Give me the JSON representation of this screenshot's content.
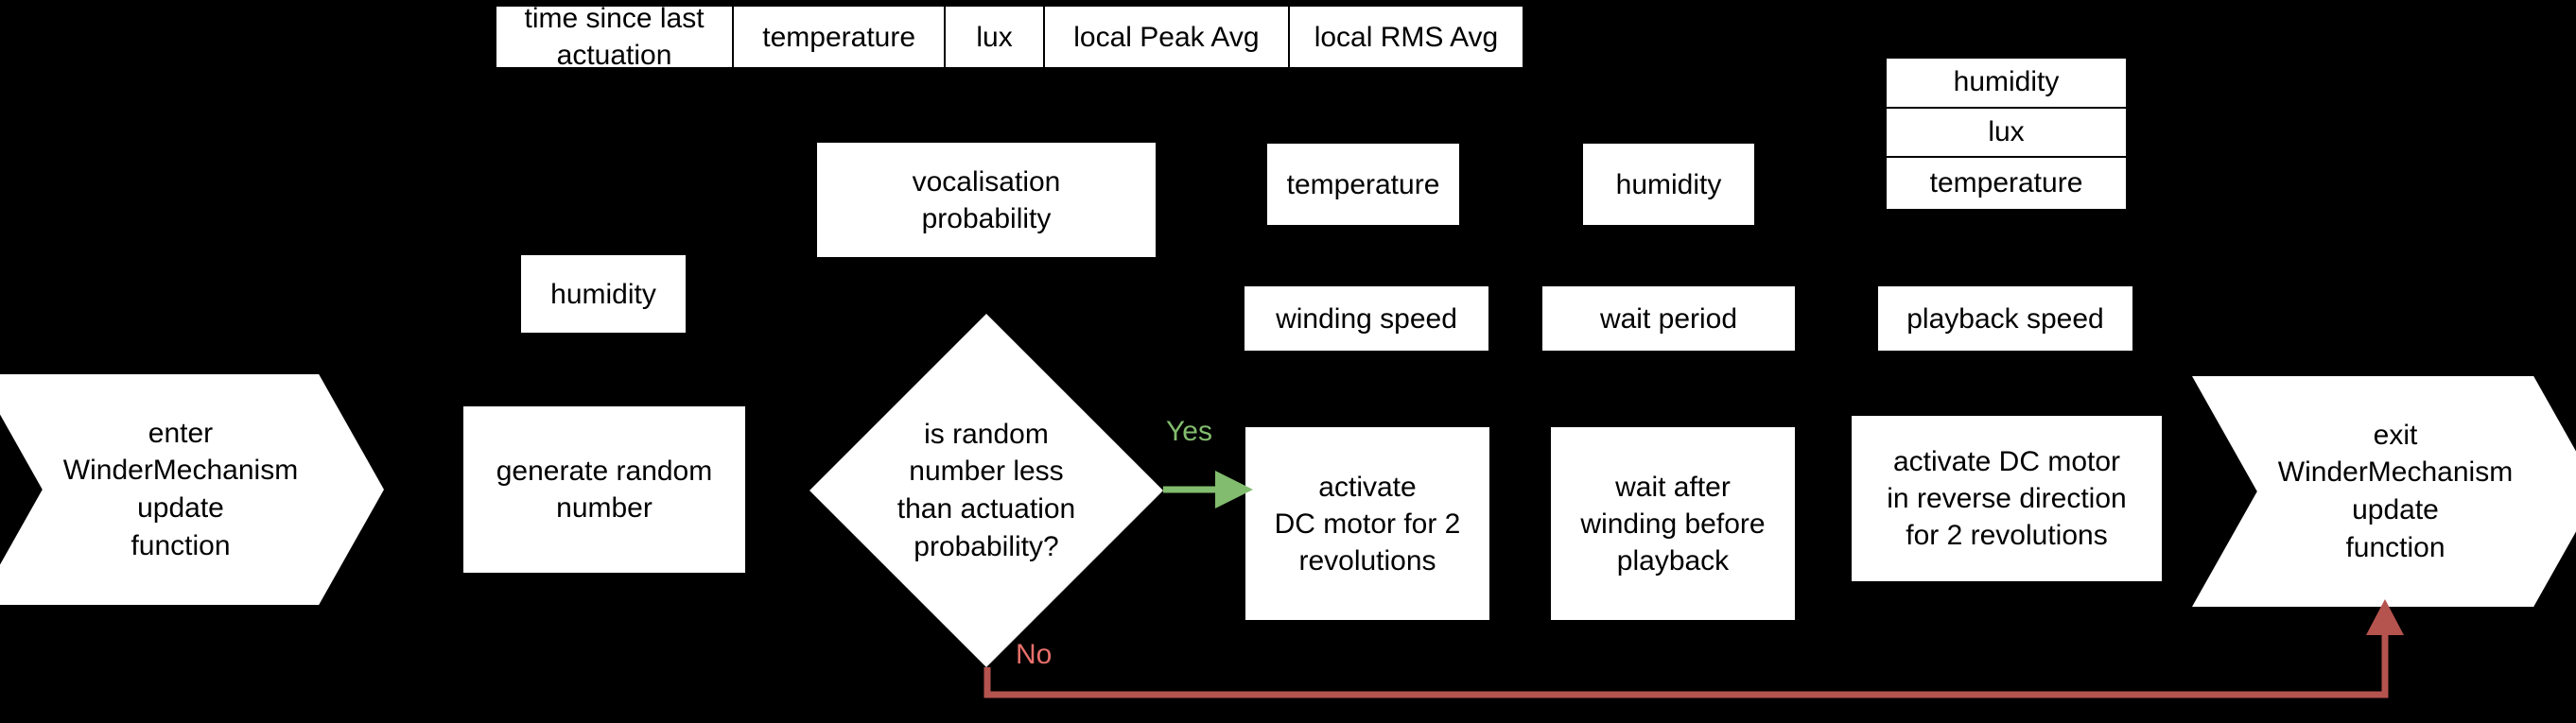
{
  "diagram": {
    "title": "WinderMechanism update function flowchart",
    "background": "#000000",
    "node_fill": "#ffffff",
    "node_stroke": "#000000",
    "yes_color": "#82bc6e",
    "no_label_color": "#e8706b",
    "no_line_color": "#b5534e"
  },
  "header_row": {
    "cells": [
      {
        "label": "time since last\nactuation"
      },
      {
        "label": "temperature"
      },
      {
        "label": "lux"
      },
      {
        "label": "local Peak Avg"
      },
      {
        "label": "local RMS Avg"
      }
    ]
  },
  "nodes": {
    "enter": {
      "label": "enter\nWinderMechanism\nupdate\nfunction"
    },
    "exit": {
      "label": "exit\nWinderMechanism\nupdate\nfunction"
    },
    "humidity_left": {
      "label": "humidity"
    },
    "generate_random_number": {
      "label": "generate random\nnumber"
    },
    "vocalisation_probability": {
      "label": "vocalisation\nprobability"
    },
    "decision": {
      "label": "is random\nnumber less\nthan actuation\nprobability?"
    },
    "temperature_mid": {
      "label": "temperature"
    },
    "winding_speed": {
      "label": "winding speed"
    },
    "activate_dc_motor": {
      "label": "activate\nDC motor for 2\nrevolutions"
    },
    "humidity_mid": {
      "label": "humidity"
    },
    "wait_period": {
      "label": "wait period"
    },
    "wait_after_winding": {
      "label": "wait after\nwinding before\nplayback"
    },
    "playback_speed": {
      "label": "playback speed"
    },
    "activate_dc_motor_reverse": {
      "label": "activate DC motor\nin reverse direction\nfor 2 revolutions"
    }
  },
  "right_stack": {
    "cells": [
      {
        "label": "humidity"
      },
      {
        "label": "lux"
      },
      {
        "label": "temperature"
      }
    ]
  },
  "edges": {
    "yes": {
      "label": "Yes"
    },
    "no": {
      "label": "No"
    }
  }
}
